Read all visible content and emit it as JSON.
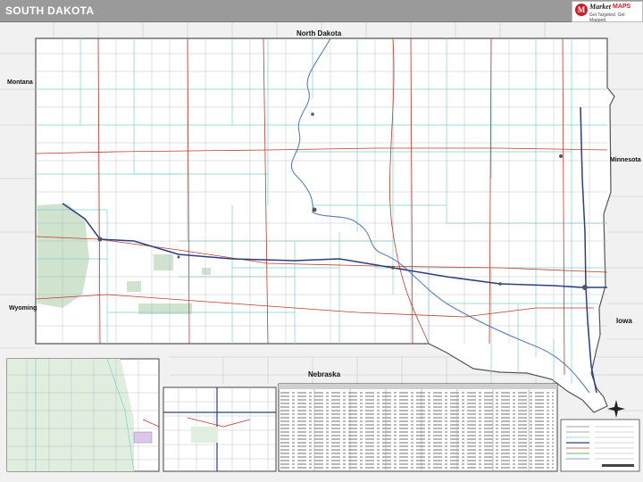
{
  "header": {
    "title": "SOUTH DAKOTA",
    "logo": {
      "mark": "M",
      "line1": "Market",
      "line2": "MAPS",
      "tagline": "Get Targeted. Get Mapped."
    }
  },
  "map": {
    "neighbors": {
      "north_dakota": "North Dakota",
      "montana": "Montana",
      "minnesota": "Minnesota",
      "wyoming": "Wyoming",
      "iowa": "Iowa",
      "nebraska": "Nebraska"
    },
    "colors": {
      "title_bar": "#9a9a9a",
      "county_line": "#7fcfcf",
      "highway": "#c0392b",
      "interstate": "#2c3e80",
      "state_border": "#555555",
      "outside_fill": "#f1f1f1",
      "park_fill": "#cfe3cf"
    }
  }
}
